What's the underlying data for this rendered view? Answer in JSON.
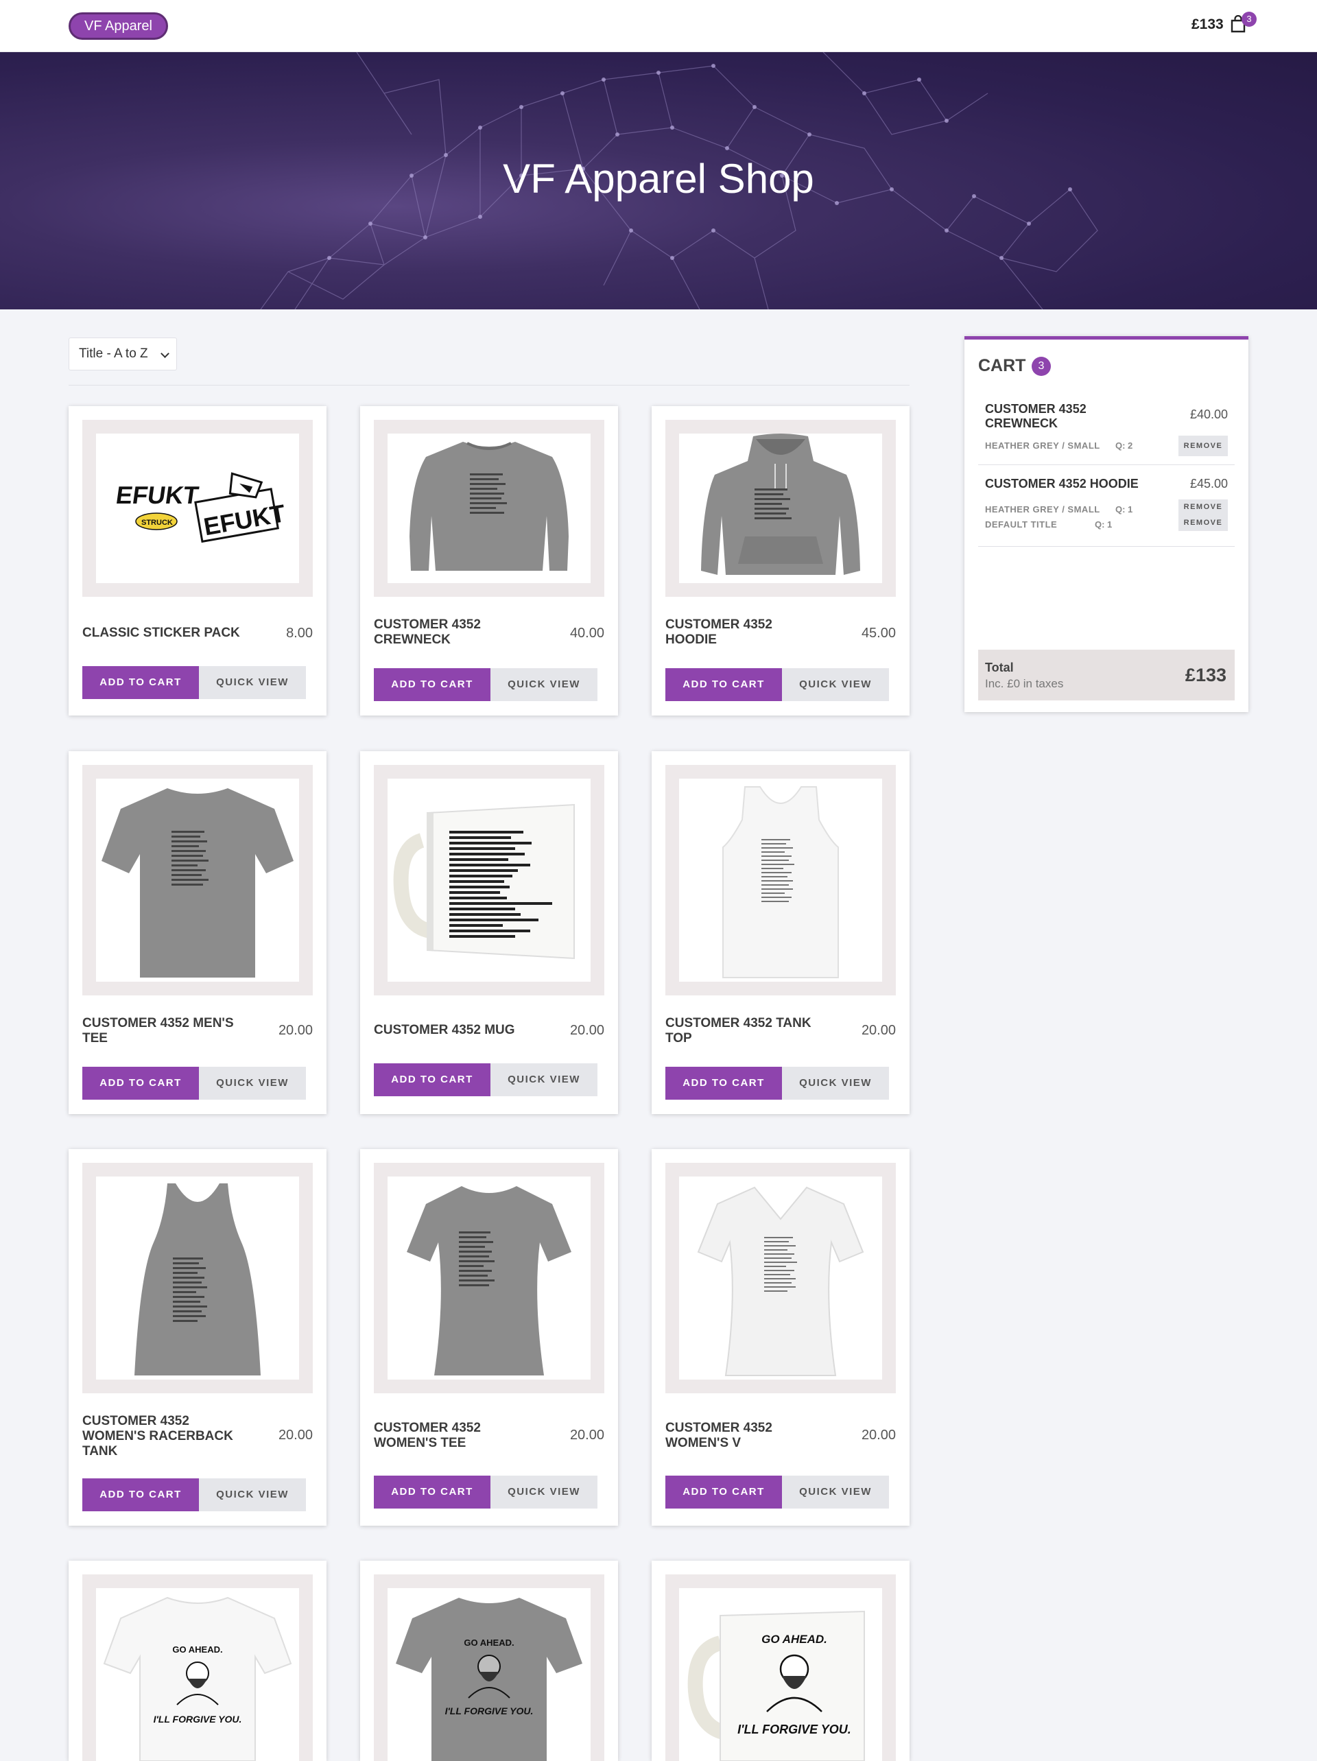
{
  "header": {
    "brand": "VF Apparel",
    "cart_total": "£133",
    "cart_count": "3"
  },
  "hero": {
    "title": "VF Apparel Shop"
  },
  "sort": {
    "selected": "Title - A to Z"
  },
  "products": [
    {
      "title": "Classic Sticker Pack",
      "price": "8.00",
      "add_label": "Add to cart",
      "quick_label": "Quick view",
      "image": "sticker-pack-image"
    },
    {
      "title": "Customer 4352 Crewneck",
      "price": "40.00",
      "add_label": "Add to cart",
      "quick_label": "Quick view",
      "image": "crewneck-image"
    },
    {
      "title": "Customer 4352 Hoodie",
      "price": "45.00",
      "add_label": "Add to cart",
      "quick_label": "Quick view",
      "image": "hoodie-image"
    },
    {
      "title": "Customer 4352 Men's Tee",
      "price": "20.00",
      "add_label": "Add to cart",
      "quick_label": "Quick view",
      "image": "mens-tee-image"
    },
    {
      "title": "Customer 4352 Mug",
      "price": "20.00",
      "add_label": "Add to cart",
      "quick_label": "Quick view",
      "image": "mug-image"
    },
    {
      "title": "Customer 4352 Tank Top",
      "price": "20.00",
      "add_label": "Add to cart",
      "quick_label": "Quick view",
      "image": "tank-top-image"
    },
    {
      "title": "Customer 4352 Women's Racerback Tank",
      "price": "20.00",
      "add_label": "Add to cart",
      "quick_label": "Quick view",
      "image": "racerback-image"
    },
    {
      "title": "Customer 4352 Women's Tee",
      "price": "20.00",
      "add_label": "Add to cart",
      "quick_label": "Quick view",
      "image": "womens-tee-image"
    },
    {
      "title": "Customer 4352 Women's V",
      "price": "20.00",
      "add_label": "Add to cart",
      "quick_label": "Quick view",
      "image": "womens-v-image"
    },
    {
      "image": "forgive-white-tee-image",
      "art_top": "GO AHEAD.",
      "art_bottom": "I'LL FORGIVE YOU."
    },
    {
      "image": "forgive-grey-tee-image",
      "art_top": "GO AHEAD.",
      "art_bottom": "I'LL FORGIVE YOU."
    },
    {
      "image": "forgive-mug-image",
      "art_top": "GO AHEAD.",
      "art_bottom": "I'LL FORGIVE YOU."
    }
  ],
  "sticker_art": {
    "logo_text": "EFUKT",
    "small_text": "STRUCK"
  },
  "cart": {
    "heading": "Cart",
    "count": "3",
    "items": [
      {
        "title": "Customer 4352 Crewneck",
        "price": "£40.00",
        "variant": "Heather Grey / Small",
        "qty": "Q: 2",
        "remove": "Remove"
      },
      {
        "title": "Customer 4352 Hoodie",
        "price": "£45.00",
        "variant": "Heather Grey / Small",
        "qty": "Q: 1",
        "remove": "Remove",
        "variant2": "Default Title",
        "qty2": "Q: 1",
        "remove2": "Remove"
      }
    ],
    "total_label": "Total",
    "tax_note": "Inc. £0 in taxes",
    "total_value": "£133"
  },
  "colors": {
    "accent": "#8e44ad",
    "hero_bg": "#2d2050",
    "page_bg": "#f3f4f8"
  }
}
